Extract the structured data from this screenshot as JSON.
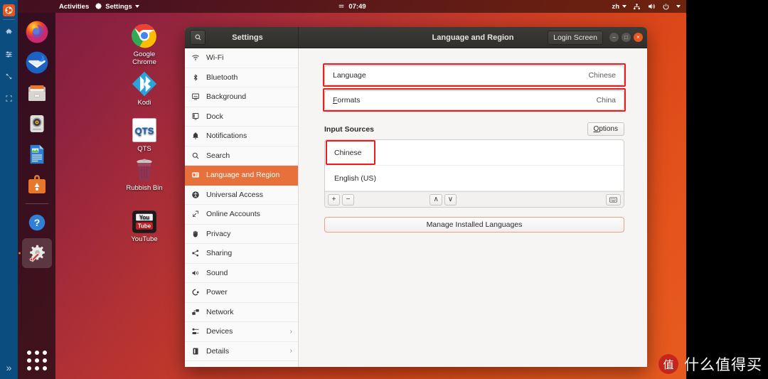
{
  "capture_bar": {
    "logo": "ubuntu-logo",
    "tools": [
      "puzzle-icon",
      "sliders-icon",
      "resize-icon",
      "crop-icon"
    ],
    "expand_label": "»"
  },
  "topbar": {
    "activities": "Activities",
    "app_menu": "Settings",
    "app_icon": "settings-gear-icon",
    "clock": "07:49",
    "clock_icon": "calendar-icon",
    "keyboard_layout": "zh",
    "status_icons": [
      "network-icon",
      "volume-icon",
      "power-icon"
    ],
    "menu_caret": "▾"
  },
  "dock": {
    "items": [
      {
        "name": "firefox",
        "label": "Firefox",
        "active": false
      },
      {
        "name": "thunderbird",
        "label": "Thunderbird",
        "active": false
      },
      {
        "name": "files",
        "label": "Files",
        "active": false
      },
      {
        "name": "rhythmbox",
        "label": "Rhythmbox",
        "active": false
      },
      {
        "name": "libreoffice-writer",
        "label": "LibreOffice Writer",
        "active": false
      },
      {
        "name": "ubuntu-software",
        "label": "Ubuntu Software",
        "active": false
      },
      {
        "name": "help",
        "label": "Help",
        "active": false
      },
      {
        "name": "settings",
        "label": "Settings",
        "active": true
      }
    ],
    "show_apps_label": "Show Applications"
  },
  "desktop_icons": [
    {
      "label": "Google\nChrome",
      "icon": "chrome-icon"
    },
    {
      "label": "Kodi",
      "icon": "kodi-icon"
    },
    {
      "label": "QTS",
      "icon": "qts-icon"
    },
    {
      "label": "Rubbish Bin",
      "icon": "trash-icon"
    },
    {
      "label": "YouTube",
      "icon": "youtube-icon"
    }
  ],
  "window": {
    "header": {
      "search_icon": "search-icon",
      "title_left": "Settings",
      "title_right": "Language and Region",
      "login_screen_button": "Login Screen",
      "controls": {
        "minimize": "−",
        "maximize": "□",
        "close": "×"
      }
    },
    "sidebar": [
      {
        "label": "Wi-Fi",
        "icon": "wifi-icon",
        "selected": false,
        "chevron": false
      },
      {
        "label": "Bluetooth",
        "icon": "bluetooth-icon",
        "selected": false,
        "chevron": false
      },
      {
        "label": "Background",
        "icon": "background-icon",
        "selected": false,
        "chevron": false
      },
      {
        "label": "Dock",
        "icon": "dock-icon",
        "selected": false,
        "chevron": false
      },
      {
        "label": "Notifications",
        "icon": "bell-icon",
        "selected": false,
        "chevron": false
      },
      {
        "label": "Search",
        "icon": "search-icon",
        "selected": false,
        "chevron": false
      },
      {
        "label": "Language and Region",
        "icon": "language-icon",
        "selected": true,
        "chevron": false
      },
      {
        "label": "Universal Access",
        "icon": "accessibility-icon",
        "selected": false,
        "chevron": false
      },
      {
        "label": "Online Accounts",
        "icon": "online-accounts-icon",
        "selected": false,
        "chevron": false
      },
      {
        "label": "Privacy",
        "icon": "privacy-hand-icon",
        "selected": false,
        "chevron": false
      },
      {
        "label": "Sharing",
        "icon": "share-icon",
        "selected": false,
        "chevron": false
      },
      {
        "label": "Sound",
        "icon": "sound-icon",
        "selected": false,
        "chevron": false
      },
      {
        "label": "Power",
        "icon": "power-plug-icon",
        "selected": false,
        "chevron": false
      },
      {
        "label": "Network",
        "icon": "network-icon",
        "selected": false,
        "chevron": false
      },
      {
        "label": "Devices",
        "icon": "devices-icon",
        "selected": false,
        "chevron": true
      },
      {
        "label": "Details",
        "icon": "details-icon",
        "selected": false,
        "chevron": true
      }
    ],
    "content": {
      "language_row": {
        "label": "Language",
        "value": "Chinese",
        "highlighted": true
      },
      "formats_row": {
        "label": "Formats",
        "mnemonic": "F",
        "value": "China",
        "highlighted": true
      },
      "input_sources": {
        "title": "Input Sources",
        "options_button": "Options",
        "options_mnemonic": "O",
        "sources": [
          {
            "label": "Chinese",
            "selected": true
          },
          {
            "label": "English (US)",
            "selected": false
          }
        ],
        "toolbar": {
          "add": "+",
          "remove": "−",
          "move_up": "∧",
          "move_down": "∨",
          "keyboard_preview": "keyboard-icon"
        }
      },
      "manage_button": "Manage Installed Languages"
    }
  },
  "watermark": {
    "badge": "值",
    "text": "什么值得买"
  },
  "colors": {
    "accent_orange": "#e8703a",
    "close_button": "#e6581f",
    "highlight_red": "#ee1c1c",
    "dock_bg": "rgba(23,8,18,0.72)",
    "capture_bar_blue": "#0c4d7f"
  }
}
